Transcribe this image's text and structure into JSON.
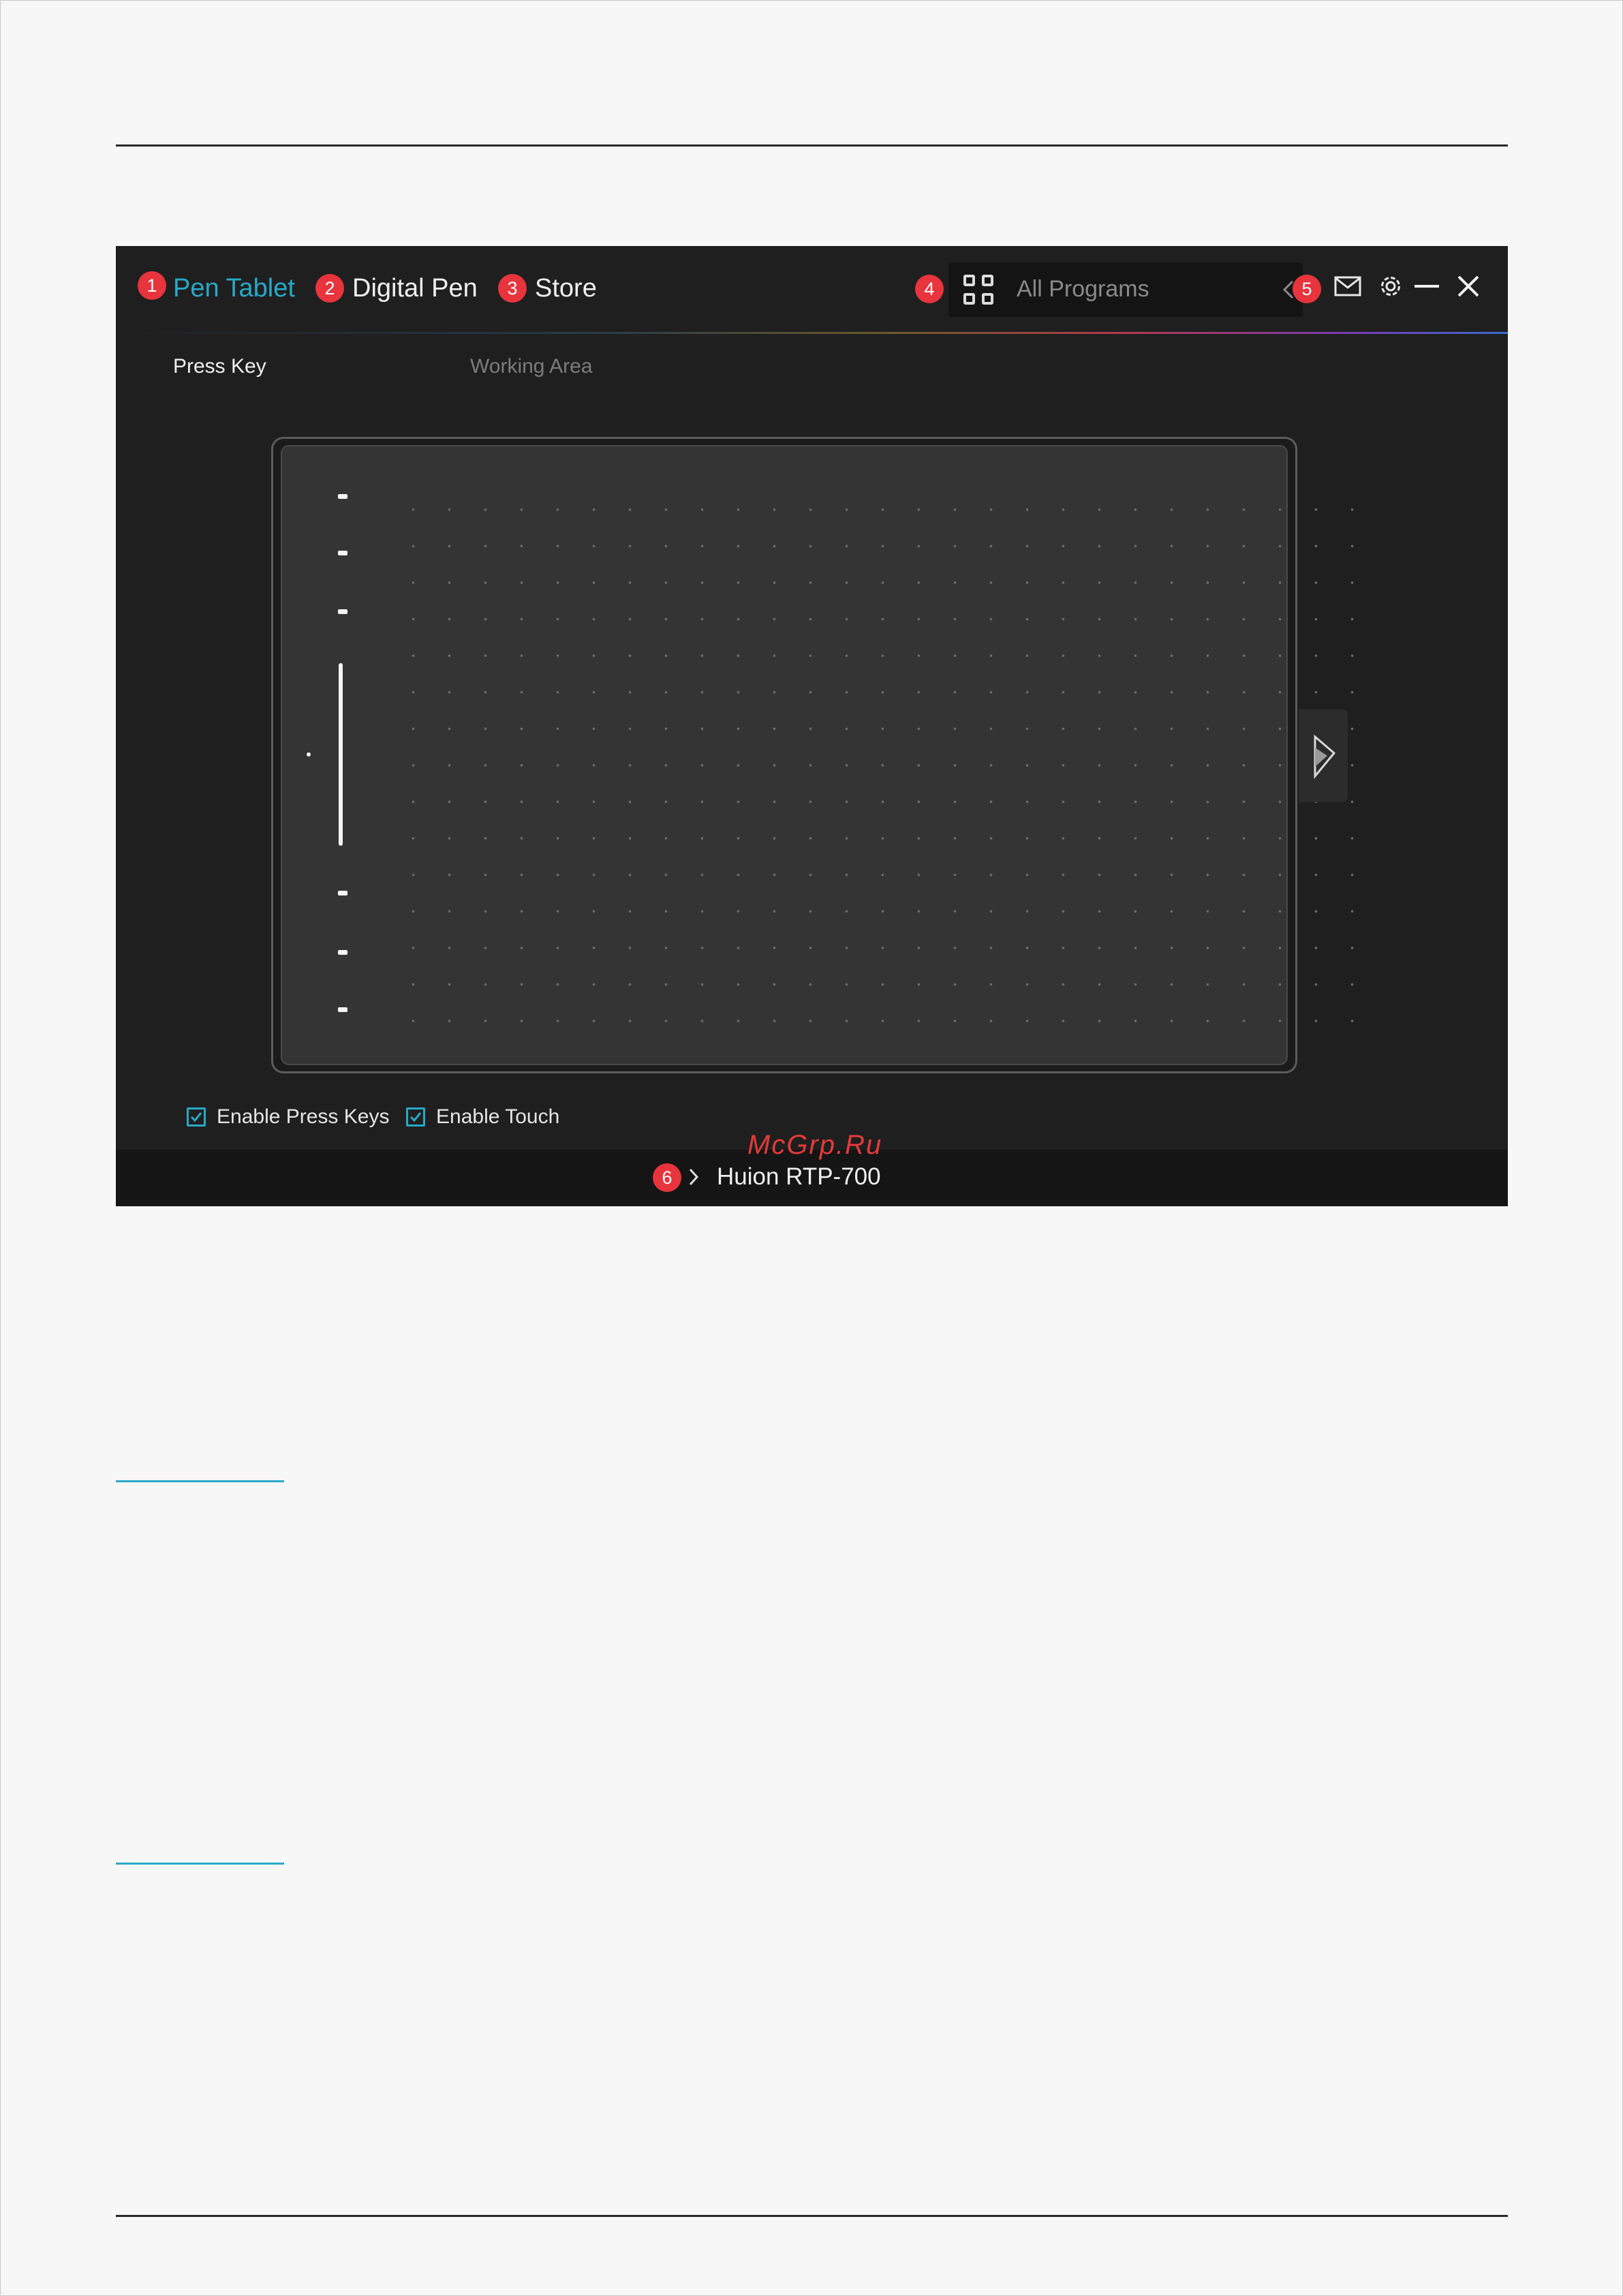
{
  "app": {
    "nav": {
      "tab_pen_tablet": "Pen Tablet",
      "tab_digital_pen": "Digital Pen",
      "tab_store": "Store"
    },
    "programs_selector": {
      "label": "All Programs"
    },
    "subtabs": {
      "press_key": "Press Key",
      "working_area": "Working Area"
    },
    "options": {
      "enable_press_keys": "Enable Press Keys",
      "enable_touch": "Enable Touch"
    },
    "footer": {
      "device_name": "Huion RTP-700"
    },
    "callouts": [
      "1",
      "2",
      "3",
      "4",
      "5",
      "6"
    ],
    "icons": [
      "grid-icon",
      "chevron-left-icon",
      "mail-icon",
      "gear-icon",
      "minimize-icon",
      "close-icon",
      "chevron-right-icon",
      "huion-logo-icon"
    ],
    "colors": {
      "accent": "#27a9c9",
      "badge": "#e8343c",
      "background": "#1f1f1f"
    }
  },
  "watermark": "McGrp.Ru"
}
